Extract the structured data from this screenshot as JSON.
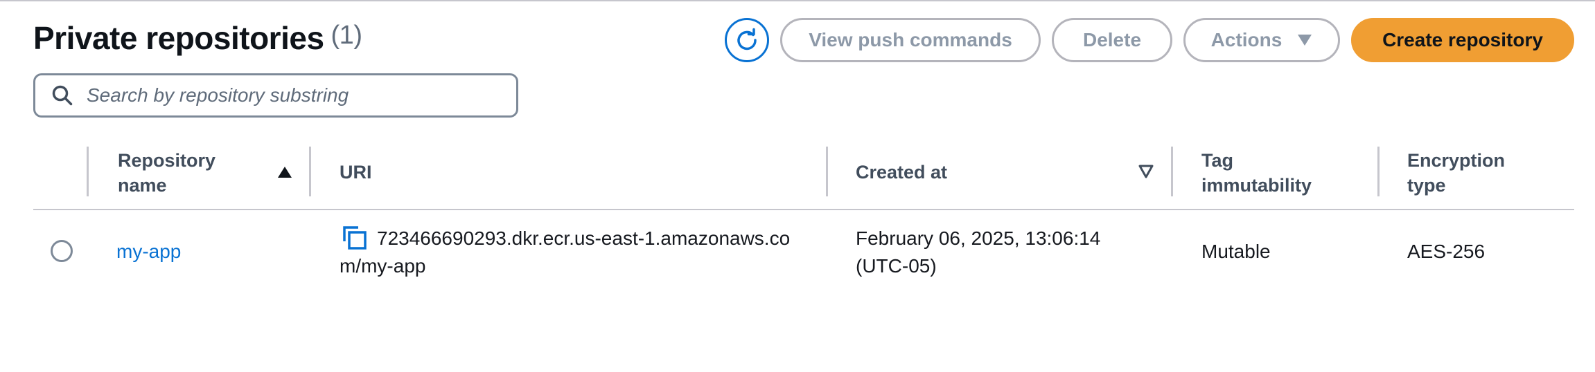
{
  "header": {
    "title": "Private repositories",
    "count": "(1)"
  },
  "toolbar": {
    "refresh_icon": "refresh-icon",
    "view_push_label": "View push commands",
    "delete_label": "Delete",
    "actions_label": "Actions",
    "create_label": "Create repository",
    "accent_color": "#f09e33"
  },
  "search": {
    "placeholder": "Search by repository substring"
  },
  "table": {
    "columns": [
      {
        "label": "Repository name",
        "sort": "ascending"
      },
      {
        "label": "URI"
      },
      {
        "label": "Created at",
        "sort": "sortable"
      },
      {
        "label": "Tag immutability"
      },
      {
        "label": "Encryption type"
      }
    ],
    "rows": [
      {
        "name": "my-app",
        "uri": "723466690293.dkr.ecr.us-east-1.amazonaws.com/my-app",
        "created_at": "February 06, 2025, 13:06:14 (UTC-05)",
        "tag_immutability": "Mutable",
        "encryption_type": "AES-256",
        "selected": false
      }
    ]
  }
}
